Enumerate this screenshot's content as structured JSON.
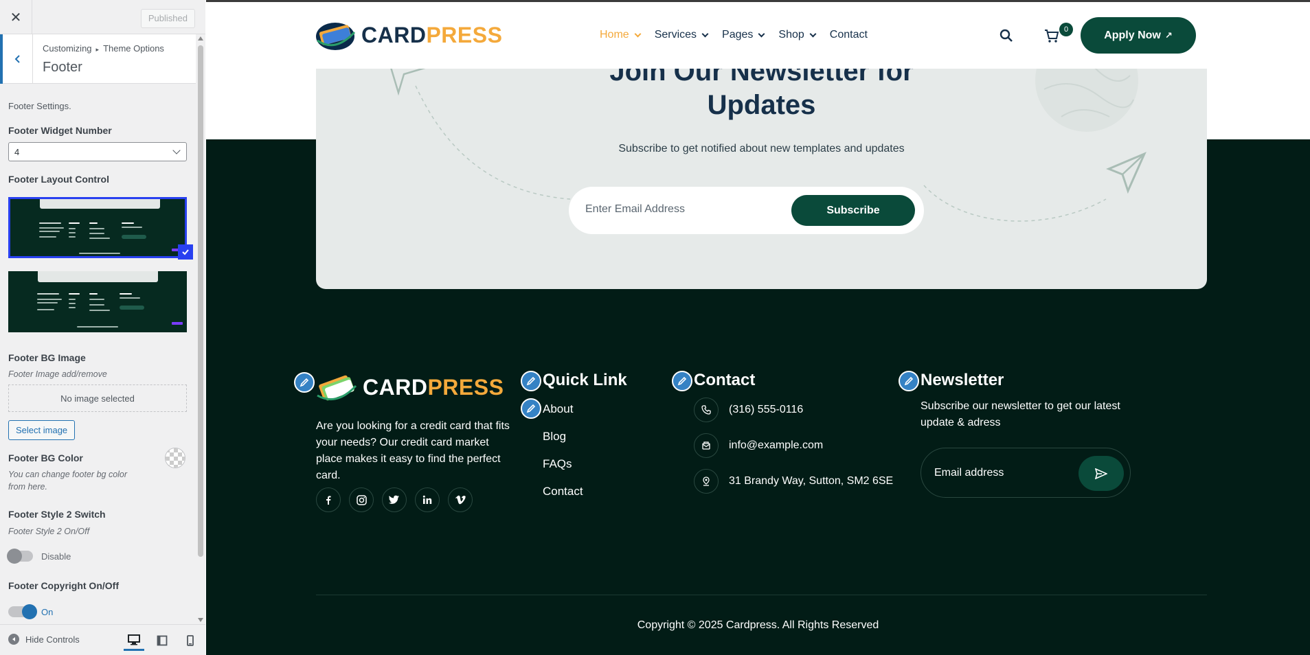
{
  "customizer": {
    "published_label": "Published",
    "breadcrumb": [
      "Customizing",
      "Theme Options"
    ],
    "section_title": "Footer",
    "settings_desc": "Footer Settings.",
    "widget_number": {
      "label": "Footer Widget Number",
      "value": "4"
    },
    "layout_control": {
      "label": "Footer Layout Control"
    },
    "bg_image": {
      "label": "Footer BG Image",
      "desc": "Footer Image add/remove",
      "empty_text": "No image selected",
      "button": "Select image"
    },
    "bg_color": {
      "label": "Footer BG Color",
      "desc_line1": "You can change footer bg color",
      "desc_line2": "from here."
    },
    "style2": {
      "label": "Footer Style 2 Switch",
      "desc": "Footer Style 2 On/Off",
      "state": "Disable"
    },
    "copyright_toggle": {
      "label": "Footer Copyright On/Off",
      "state": "On"
    },
    "hide_controls": "Hide Controls",
    "accent_color": "#2271b1",
    "toggle_on_color": "#2271b1"
  },
  "site": {
    "logo": {
      "part1": "CARD",
      "part2": "PRESS"
    },
    "nav": [
      {
        "label": "Home",
        "has_dropdown": true,
        "active": true
      },
      {
        "label": "Services",
        "has_dropdown": true
      },
      {
        "label": "Pages",
        "has_dropdown": true
      },
      {
        "label": "Shop",
        "has_dropdown": true
      },
      {
        "label": "Contact",
        "has_dropdown": false
      }
    ],
    "cart_count": "0",
    "apply_button": "Apply Now",
    "newsletter": {
      "title_line1": "Join Our Newsletter for",
      "title_line2": "Updates",
      "subtitle": "Subscribe to get notified about new templates and updates",
      "placeholder": "Enter Email Address",
      "button": "Subscribe"
    },
    "footer": {
      "about": "Are you looking for a credit card that fits your needs? Our credit card market place makes it easy to find the perfect card.",
      "social": [
        "facebook-icon",
        "instagram-icon",
        "twitter-icon",
        "linkedin-icon",
        "vimeo-icon"
      ],
      "quick_link": {
        "heading": "Quick Link",
        "links": [
          "About",
          "Blog",
          "FAQs",
          "Contact"
        ]
      },
      "contact": {
        "heading": "Contact",
        "phone": "(316) 555-0116",
        "email": "info@example.com",
        "address": "31 Brandy Way, Sutton, SM2 6SE"
      },
      "newsletter": {
        "heading": "Newsletter",
        "text": "Subscribe our newsletter to get our latest update & adress",
        "placeholder": "Email address"
      },
      "copyright": "Copyright © 2025 Cardpress. All Rights Reserved"
    },
    "colors": {
      "primary": "#0a4a3a",
      "accent": "#f4a93b",
      "footer_bg": "#021c16",
      "navy": "#16304a"
    }
  }
}
